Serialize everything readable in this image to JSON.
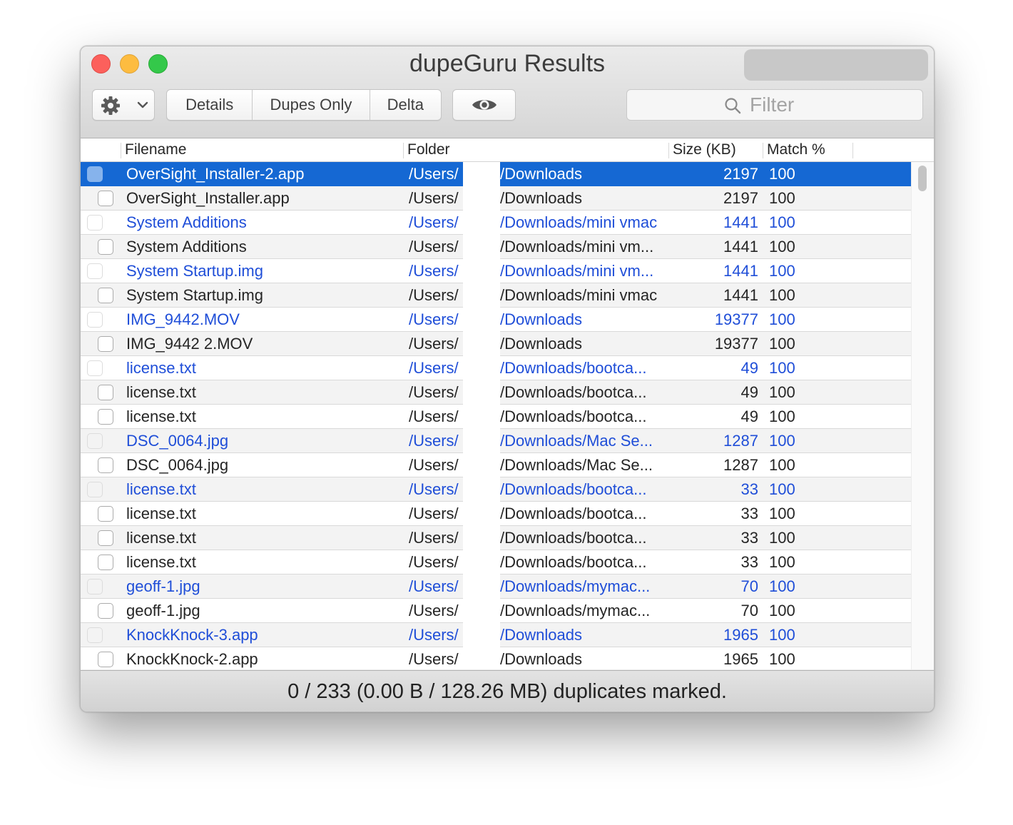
{
  "window": {
    "title": "dupeGuru Results"
  },
  "toolbar": {
    "segments": {
      "details": "Details",
      "dupes_only": "Dupes Only",
      "delta": "Delta"
    },
    "filter_placeholder": "Filter",
    "icons": [
      "gear-icon",
      "chevron-down-icon",
      "eye-icon",
      "search-icon"
    ]
  },
  "columns": {
    "filename": "Filename",
    "folder": "Folder",
    "size": "Size (KB)",
    "match": "Match %"
  },
  "colors": {
    "selection": "#1568d3",
    "reference_text": "#1f4ed8",
    "duplicate_text": "#252525"
  },
  "rows": [
    {
      "kind": "selected",
      "filename": "OverSight_Installer-2.app",
      "folder_a": "/Users/",
      "folder_b": "/Downloads",
      "size": "2197",
      "match": "100"
    },
    {
      "kind": "dup",
      "filename": "OverSight_Installer.app",
      "folder_a": "/Users/",
      "folder_b": "/Downloads",
      "size": "2197",
      "match": "100"
    },
    {
      "kind": "ref",
      "filename": "System Additions",
      "folder_a": "/Users/",
      "folder_b": "/Downloads/mini vmac",
      "size": "1441",
      "match": "100"
    },
    {
      "kind": "dup",
      "filename": "System Additions",
      "folder_a": "/Users/",
      "folder_b": "/Downloads/mini vm...",
      "size": "1441",
      "match": "100"
    },
    {
      "kind": "ref",
      "filename": "System Startup.img",
      "folder_a": "/Users/",
      "folder_b": "/Downloads/mini vm...",
      "size": "1441",
      "match": "100"
    },
    {
      "kind": "dup",
      "filename": "System Startup.img",
      "folder_a": "/Users/",
      "folder_b": "/Downloads/mini vmac",
      "size": "1441",
      "match": "100"
    },
    {
      "kind": "ref",
      "filename": "IMG_9442.MOV",
      "folder_a": "/Users/",
      "folder_b": "/Downloads",
      "size": "19377",
      "match": "100"
    },
    {
      "kind": "dup",
      "filename": "IMG_9442 2.MOV",
      "folder_a": "/Users/",
      "folder_b": "/Downloads",
      "size": "19377",
      "match": "100"
    },
    {
      "kind": "ref",
      "filename": "license.txt",
      "folder_a": "/Users/",
      "folder_b": "/Downloads/bootca...",
      "size": "49",
      "match": "100"
    },
    {
      "kind": "dup",
      "filename": "license.txt",
      "folder_a": "/Users/",
      "folder_b": "/Downloads/bootca...",
      "size": "49",
      "match": "100"
    },
    {
      "kind": "dup",
      "filename": "license.txt",
      "folder_a": "/Users/",
      "folder_b": "/Downloads/bootca...",
      "size": "49",
      "match": "100"
    },
    {
      "kind": "ref",
      "filename": "DSC_0064.jpg",
      "folder_a": "/Users/",
      "folder_b": "/Downloads/Mac Se...",
      "size": "1287",
      "match": "100"
    },
    {
      "kind": "dup",
      "filename": "DSC_0064.jpg",
      "folder_a": "/Users/",
      "folder_b": "/Downloads/Mac Se...",
      "size": "1287",
      "match": "100"
    },
    {
      "kind": "ref",
      "filename": "license.txt",
      "folder_a": "/Users/",
      "folder_b": "/Downloads/bootca...",
      "size": "33",
      "match": "100"
    },
    {
      "kind": "dup",
      "filename": "license.txt",
      "folder_a": "/Users/",
      "folder_b": "/Downloads/bootca...",
      "size": "33",
      "match": "100"
    },
    {
      "kind": "dup",
      "filename": "license.txt",
      "folder_a": "/Users/",
      "folder_b": "/Downloads/bootca...",
      "size": "33",
      "match": "100"
    },
    {
      "kind": "dup",
      "filename": "license.txt",
      "folder_a": "/Users/",
      "folder_b": "/Downloads/bootca...",
      "size": "33",
      "match": "100"
    },
    {
      "kind": "ref",
      "filename": "geoff-1.jpg",
      "folder_a": "/Users/",
      "folder_b": "/Downloads/mymac...",
      "size": "70",
      "match": "100"
    },
    {
      "kind": "dup",
      "filename": "geoff-1.jpg",
      "folder_a": "/Users/",
      "folder_b": "/Downloads/mymac...",
      "size": "70",
      "match": "100"
    },
    {
      "kind": "ref",
      "filename": "KnockKnock-3.app",
      "folder_a": "/Users/",
      "folder_b": "/Downloads",
      "size": "1965",
      "match": "100"
    },
    {
      "kind": "dup",
      "filename": "KnockKnock-2.app",
      "folder_a": "/Users/",
      "folder_b": "/Downloads",
      "size": "1965",
      "match": "100"
    }
  ],
  "status": {
    "text": "0 / 233 (0.00 B / 128.26 MB) duplicates marked."
  }
}
